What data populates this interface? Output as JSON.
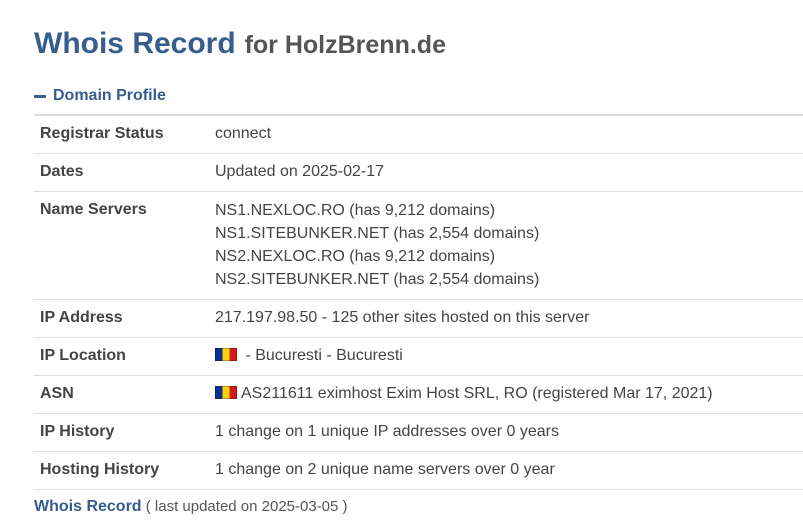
{
  "header": {
    "title_main": "Whois Record",
    "title_sub": "for HolzBrenn.de"
  },
  "section": {
    "title": "Domain Profile"
  },
  "rows": [
    {
      "label": "Registrar Status",
      "value": "connect"
    },
    {
      "label": "Dates",
      "value": "Updated on 2025-02-17"
    },
    {
      "label": "Name Servers",
      "lines": [
        "NS1.NEXLOC.RO (has 9,212 domains)",
        "NS1.SITEBUNKER.NET (has 2,554 domains)",
        "NS2.NEXLOC.RO (has 9,212 domains)",
        "NS2.SITEBUNKER.NET (has 2,554 domains)"
      ]
    },
    {
      "label": "IP Address",
      "value": "217.197.98.50 - 125 other sites hosted on this server"
    },
    {
      "label": "IP Location",
      "value": " - Bucuresti - Bucuresti",
      "flag": "romania-flag-icon"
    },
    {
      "label": "ASN",
      "value": "AS211611 eximhost Exim Host SRL, RO (registered Mar 17, 2021)",
      "flag": "romania-flag-icon"
    },
    {
      "label": "IP History",
      "value": "1 change on 1 unique IP addresses over 0 years"
    },
    {
      "label": "Hosting History",
      "value": "1 change on 2 unique name servers over 0 year"
    }
  ],
  "footer": {
    "link": "Whois Record",
    "note": " ( last updated on 2025-03-05 )"
  },
  "colors": {
    "accent": "#365d8c",
    "text": "#444444"
  }
}
